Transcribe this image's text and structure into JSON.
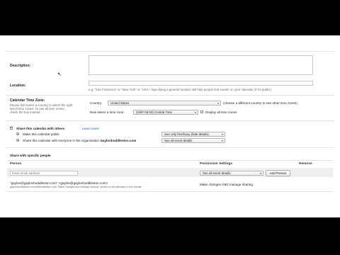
{
  "form": {
    "description_label": "Description:",
    "location_label": "Location:",
    "location_hint": "e.g. \"San Francisco\" or \"New York\" or \"USA.\" Specifying a general location will help people find events on your calendar (if it's public)",
    "timezone": {
      "label": "Calendar Time Zone:",
      "help_line1": "Please first select a country to select the right",
      "help_line2": "set of time zones. To see all time zones,",
      "help_line3": "check the box instead.",
      "country_label": "Country:",
      "country_value": "United States",
      "country_hint": "(choose a different country to see other time zones)",
      "now_select_label": "Now select a time zone:",
      "timezone_value": "(GMT-06:00) Central Time",
      "display_all_label": "Display all time zones"
    },
    "share": {
      "share_checkbox_label": "Share this calendar with others",
      "learn_more": "Learn more",
      "make_public_label": "Make this calendar public",
      "make_public_select": "See only free/busy (hide details)",
      "share_org_label_prefix": "Share this calendar with everyone in the organization",
      "share_org_name": "Gaylonhuddleston.com",
      "share_org_select": "See all event details"
    },
    "specific": {
      "heading": "Share with specific people",
      "col_person": "Person",
      "col_permission": "Permission Settings",
      "col_remove": "Remove",
      "email_placeholder": "Enter email address",
      "new_permission": "See all event details",
      "add_person": "Add Person",
      "owner_line": "\"gaylon@gaylonhuddleston.com\" <gaylon@gaylonhuddleston.com>",
      "owner_sub": "gaylonhuddleston.com/administrator/ and \"Make changes and manage sharing\" access to all calendars in the domain",
      "owner_permission": "Make changes AND manage sharing"
    }
  },
  "colors": {
    "link": "#1155cc",
    "page_background": "#ffffff",
    "letterbox": "#000000"
  }
}
